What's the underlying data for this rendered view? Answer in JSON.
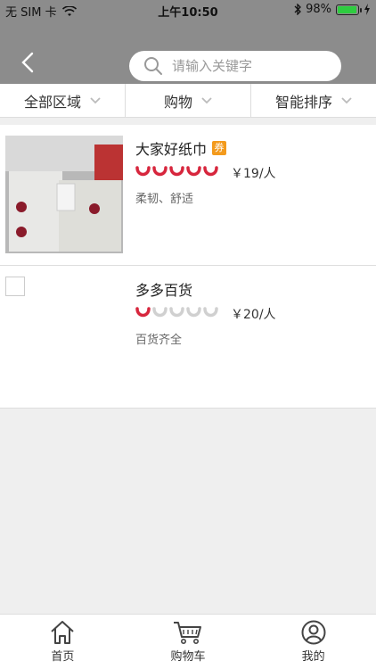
{
  "status_bar": {
    "carrier": "无 SIM 卡",
    "time": "上午10:50",
    "battery": "98%",
    "battery_level": 0.98
  },
  "search": {
    "placeholder": "请输入关键字"
  },
  "filters": [
    {
      "label": "全部区域"
    },
    {
      "label": "购物"
    },
    {
      "label": "智能排序"
    }
  ],
  "shops": [
    {
      "name": "大家好纸巾",
      "badge": "券",
      "price": "￥19/人",
      "desc": "柔韧、舒适",
      "rating": 5
    },
    {
      "name": "多多百货",
      "badge": "",
      "price": "￥20/人",
      "desc": "百货齐全",
      "rating": 1
    }
  ],
  "tabbar": [
    {
      "label": "首页",
      "icon": "home-icon"
    },
    {
      "label": "购物车",
      "icon": "cart-icon"
    },
    {
      "label": "我的",
      "icon": "user-icon"
    }
  ],
  "colors": {
    "header": "#8c8c8c",
    "rating_active": "#d7263d",
    "rating_inactive": "#d0d0d0",
    "coupon": "#f39a1c"
  }
}
